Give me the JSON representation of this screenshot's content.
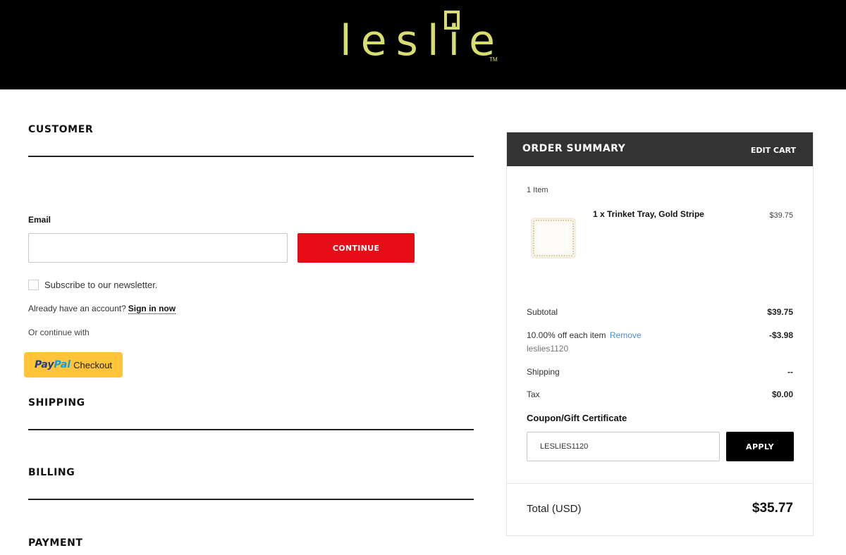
{
  "brand": {
    "logo_text": "leslie",
    "trademark": "TM",
    "accent_color": "#d9dc6e"
  },
  "checkout": {
    "sections": {
      "customer": "CUSTOMER",
      "shipping": "SHIPPING",
      "billing": "BILLING",
      "payment": "PAYMENT"
    },
    "customer": {
      "email_label": "Email",
      "email_value": "",
      "continue_label": "CONTINUE",
      "newsletter_label": "Subscribe to our newsletter.",
      "newsletter_checked": false,
      "account_prompt": "Already have an account?",
      "signin_label": "Sign in now",
      "continue_with": "Or continue with",
      "paypal": {
        "pay": "Pay",
        "pal": "Pal",
        "checkout": "Checkout"
      }
    }
  },
  "summary": {
    "title": "ORDER SUMMARY",
    "edit_cart": "EDIT CART",
    "item_count": "1 Item",
    "items": [
      {
        "name": "1 x Trinket Tray, Gold Stripe",
        "price": "$39.75",
        "thumb_icon": "trinket-tray-image"
      }
    ],
    "subtotal_label": "Subtotal",
    "subtotal_value": "$39.75",
    "discount_label": "10.00% off each item",
    "discount_remove": "Remove",
    "discount_code": "leslies1120",
    "discount_value": "-$3.98",
    "shipping_label": "Shipping",
    "shipping_value": "--",
    "tax_label": "Tax",
    "tax_value": "$0.00",
    "coupon_label": "Coupon/Gift Certificate",
    "coupon_value": "LESLIES1120",
    "apply_label": "APPLY",
    "total_label": "Total (USD)",
    "total_value": "$35.77"
  },
  "colors": {
    "header_bg": "#000000",
    "continue_button": "#e60d16",
    "paypal_button": "#ffc439",
    "summary_header": "#333333",
    "link_blue": "#4a8fd6"
  }
}
